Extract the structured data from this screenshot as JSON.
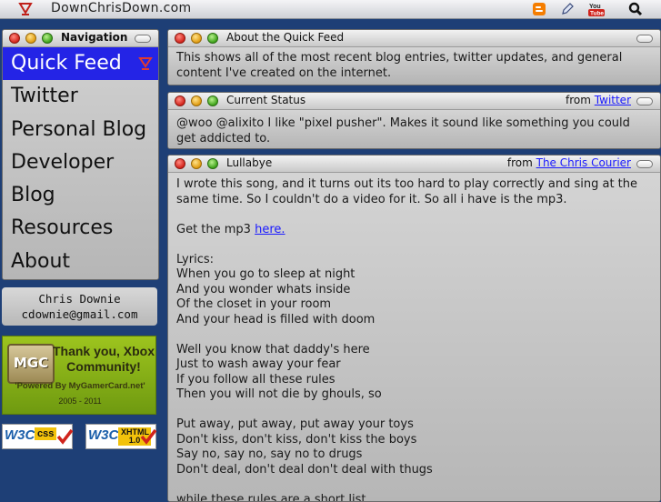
{
  "header": {
    "site_title": "DownChrisDown.com",
    "icons": [
      "logo-icon",
      "blogger-icon",
      "pen-icon",
      "youtube-icon",
      "search-icon"
    ]
  },
  "nav": {
    "title": "Navigation",
    "items": [
      {
        "label": "Quick Feed",
        "active": true
      },
      {
        "label": "Twitter"
      },
      {
        "label": "Personal Blog"
      },
      {
        "label": "Developer"
      },
      {
        "label": "Blog"
      },
      {
        "label": "Resources"
      },
      {
        "label": "About"
      }
    ]
  },
  "contact": {
    "name": "Chris Downie",
    "email": "cdownie@gmail.com"
  },
  "badge": {
    "logo": "MGC",
    "thanks_line1": "Thank you, Xbox",
    "thanks_line2": "Community!",
    "powered": "'Powered By MyGamerCard.net'",
    "years": "2005 - 2011"
  },
  "validators": [
    {
      "logo": "W3C",
      "label": "css"
    },
    {
      "logo": "W3C",
      "label": "XHTML 1.0"
    }
  ],
  "panels": {
    "about": {
      "title": "About the Quick Feed",
      "text": "This shows all of the most recent blog entries, twitter updates, and general content I've created on the internet."
    },
    "status": {
      "title": "Current Status",
      "from_prefix": "from",
      "from_link": "Twitter",
      "text": "@woo @alixito I like \"pixel pusher\". Makes it sound like something you could get addicted to."
    },
    "lullabye": {
      "title": "Lullabye",
      "from_prefix": "from",
      "from_link": "The Chris Courier",
      "intro": "I wrote this song, and it turns out its too hard to play correctly and sing at the same time. So I couldn't do a video for it. So all i have is the mp3.",
      "mp3_prefix": "Get the mp3",
      "mp3_link": "here.",
      "lyrics_label": "Lyrics:",
      "verse1": [
        "When you go to sleep at night",
        "And you wonder whats inside",
        "Of the closet in your room",
        "And your head is filled with doom"
      ],
      "verse2": [
        "Well you know that daddy's here",
        "Just to wash away your fear",
        "If you follow all these rules",
        "Then you will not die by ghouls, so"
      ],
      "verse3": [
        "Put away, put away, put away your toys",
        "Don't kiss, don't kiss, don't kiss the boys",
        "Say no, say no, say no to drugs",
        "Don't deal, don't deal don't deal with thugs"
      ],
      "trailing": "while these rules are a short list"
    }
  }
}
